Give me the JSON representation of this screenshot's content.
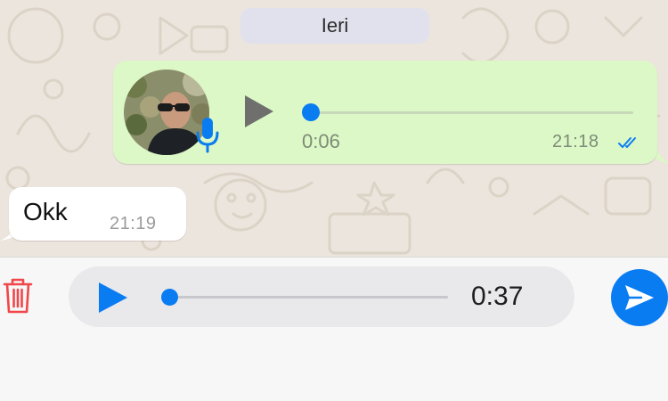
{
  "chat": {
    "date_label": "Ieri",
    "outgoing_voice": {
      "duration": "0:06",
      "time": "21:18",
      "progress": 0.0,
      "status": "read"
    },
    "incoming_text": {
      "text": "Okk",
      "time": "21:19"
    }
  },
  "composer": {
    "recording_duration": "0:37",
    "progress": 0.0
  },
  "colors": {
    "chat_background": "#ece5dd",
    "outgoing_bubble": "#dcf8c6",
    "accent_blue": "#0a7cf2",
    "delete_red": "#f0474a"
  },
  "icons": {
    "delete": "trash-icon",
    "play_voice": "play-icon",
    "mic_badge": "microphone-icon",
    "read_receipt": "double-check-icon",
    "send": "send-icon"
  }
}
